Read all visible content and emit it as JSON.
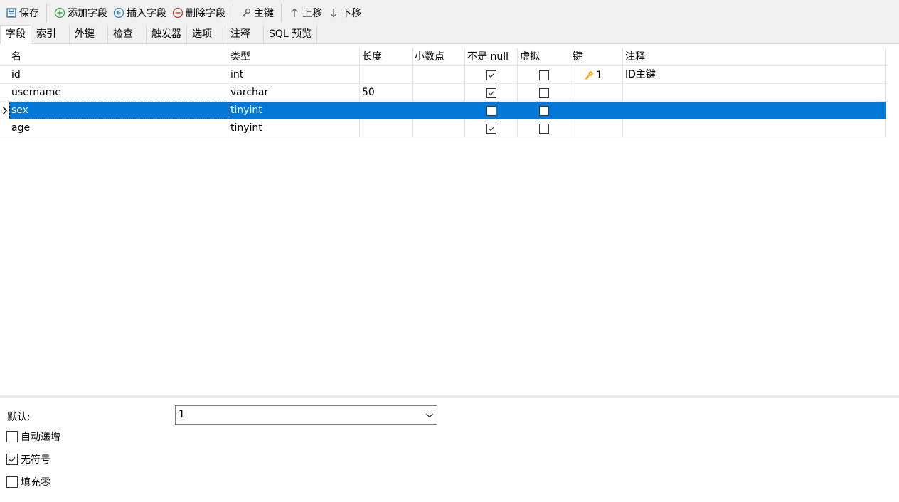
{
  "toolbar": {
    "save": "保存",
    "add_field": "添加字段",
    "insert_field": "插入字段",
    "delete_field": "删除字段",
    "primary_key": "主键",
    "move_up": "上移",
    "move_down": "下移"
  },
  "tabs": [
    "字段",
    "索引",
    "外键",
    "检查",
    "触发器",
    "选项",
    "注释",
    "SQL 预览"
  ],
  "columns": {
    "name": "名",
    "type": "类型",
    "length": "长度",
    "decimals": "小数点",
    "not_null": "不是 null",
    "virtual": "虚拟",
    "key": "键",
    "comment": "注释"
  },
  "rows": [
    {
      "name": "id",
      "type": "int",
      "length": "",
      "decimals": "",
      "not_null": true,
      "virtual": false,
      "key": "1",
      "comment": "ID主键"
    },
    {
      "name": "username",
      "type": "varchar",
      "length": "50",
      "decimals": "",
      "not_null": true,
      "virtual": false,
      "key": "",
      "comment": ""
    },
    {
      "name": "sex",
      "type": "tinyint",
      "length": "",
      "decimals": "",
      "not_null": false,
      "virtual": false,
      "key": "",
      "comment": ""
    },
    {
      "name": "age",
      "type": "tinyint",
      "length": "",
      "decimals": "",
      "not_null": true,
      "virtual": false,
      "key": "",
      "comment": ""
    }
  ],
  "props": {
    "default_label": "默认:",
    "default_value": "1",
    "auto_increment": "自动递增",
    "auto_increment_checked": false,
    "unsigned": "无符号",
    "unsigned_checked": true,
    "zerofill": "填充零",
    "zerofill_checked": false
  },
  "colors": {
    "selection": "#0078d7",
    "key_icon": "#f0a30a",
    "add_icon": "#3aa53a",
    "insert_icon": "#2b7cd3",
    "delete_icon": "#d9342b"
  },
  "icons": {
    "save": "save-icon",
    "add": "plus-circle-icon",
    "insert": "insert-circle-icon",
    "delete": "minus-circle-icon",
    "key": "key-icon",
    "up": "arrow-up-icon",
    "down": "arrow-down-icon"
  }
}
